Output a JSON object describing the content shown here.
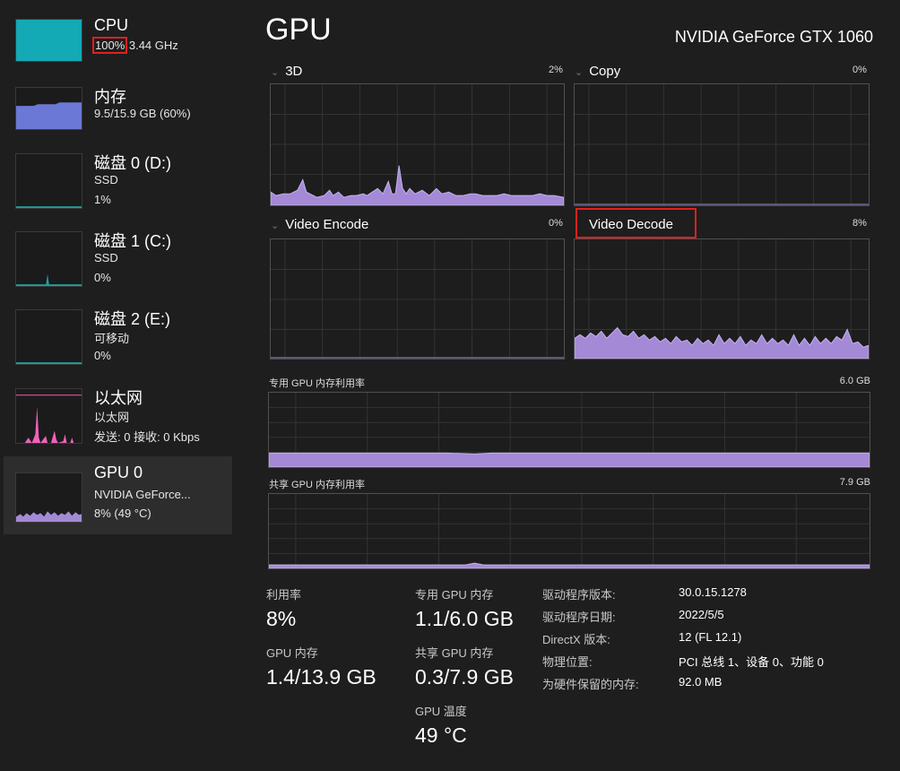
{
  "colors": {
    "cpu": "#13a9b5",
    "memory": "#6b78d6",
    "disk": "#1f9e9e",
    "ethernet": "#f062b8",
    "gpu": "#a48ad6",
    "highlight": "#e02020"
  },
  "sidebar": {
    "items": [
      {
        "title": "CPU",
        "line2_pct": "100%",
        "line2_rest": " 3.44 GHz"
      },
      {
        "title": "内存",
        "line2": "9.5/15.9 GB (60%)"
      },
      {
        "title": "磁盘 0 (D:)",
        "line2": "SSD",
        "line3": "1%"
      },
      {
        "title": "磁盘 1 (C:)",
        "line2": "SSD",
        "line3": "0%"
      },
      {
        "title": "磁盘 2 (E:)",
        "line2": "可移动",
        "line3": "0%"
      },
      {
        "title": "以太网",
        "line2": "以太网",
        "line3": "发送: 0 接收: 0 Kbps"
      },
      {
        "title": "GPU 0",
        "line2": "NVIDIA GeForce...",
        "line3": "8% (49 °C)"
      }
    ]
  },
  "header": {
    "title": "GPU",
    "gpu_name": "NVIDIA GeForce GTX 1060"
  },
  "engines": [
    {
      "label": "3D",
      "percent": "2%"
    },
    {
      "label": "Copy",
      "percent": "0%"
    },
    {
      "label": "Video Encode",
      "percent": "0%"
    },
    {
      "label": "Video Decode",
      "percent": "8%"
    }
  ],
  "memory_graphs": {
    "dedicated": {
      "label": "专用 GPU 内存利用率",
      "max": "6.0 GB"
    },
    "shared": {
      "label": "共享 GPU 内存利用率",
      "max": "7.9 GB"
    }
  },
  "stats": {
    "utilization": {
      "label": "利用率",
      "value": "8%"
    },
    "dedicated_mem": {
      "label": "专用 GPU 内存",
      "value": "1.1/6.0 GB"
    },
    "gpu_mem": {
      "label": "GPU 内存",
      "value": "1.4/13.9 GB"
    },
    "shared_mem": {
      "label": "共享 GPU 内存",
      "value": "0.3/7.9 GB"
    },
    "temperature": {
      "label": "GPU 温度",
      "value": "49 °C"
    }
  },
  "info": [
    {
      "key": "驱动程序版本:",
      "value": "30.0.15.1278"
    },
    {
      "key": "驱动程序日期:",
      "value": "2022/5/5"
    },
    {
      "key": "DirectX 版本:",
      "value": "12 (FL 12.1)"
    },
    {
      "key": "物理位置:",
      "value": "PCI 总线 1、设备 0、功能 0"
    },
    {
      "key": "为硬件保留的内存:",
      "value": "92.0 MB"
    }
  ]
}
